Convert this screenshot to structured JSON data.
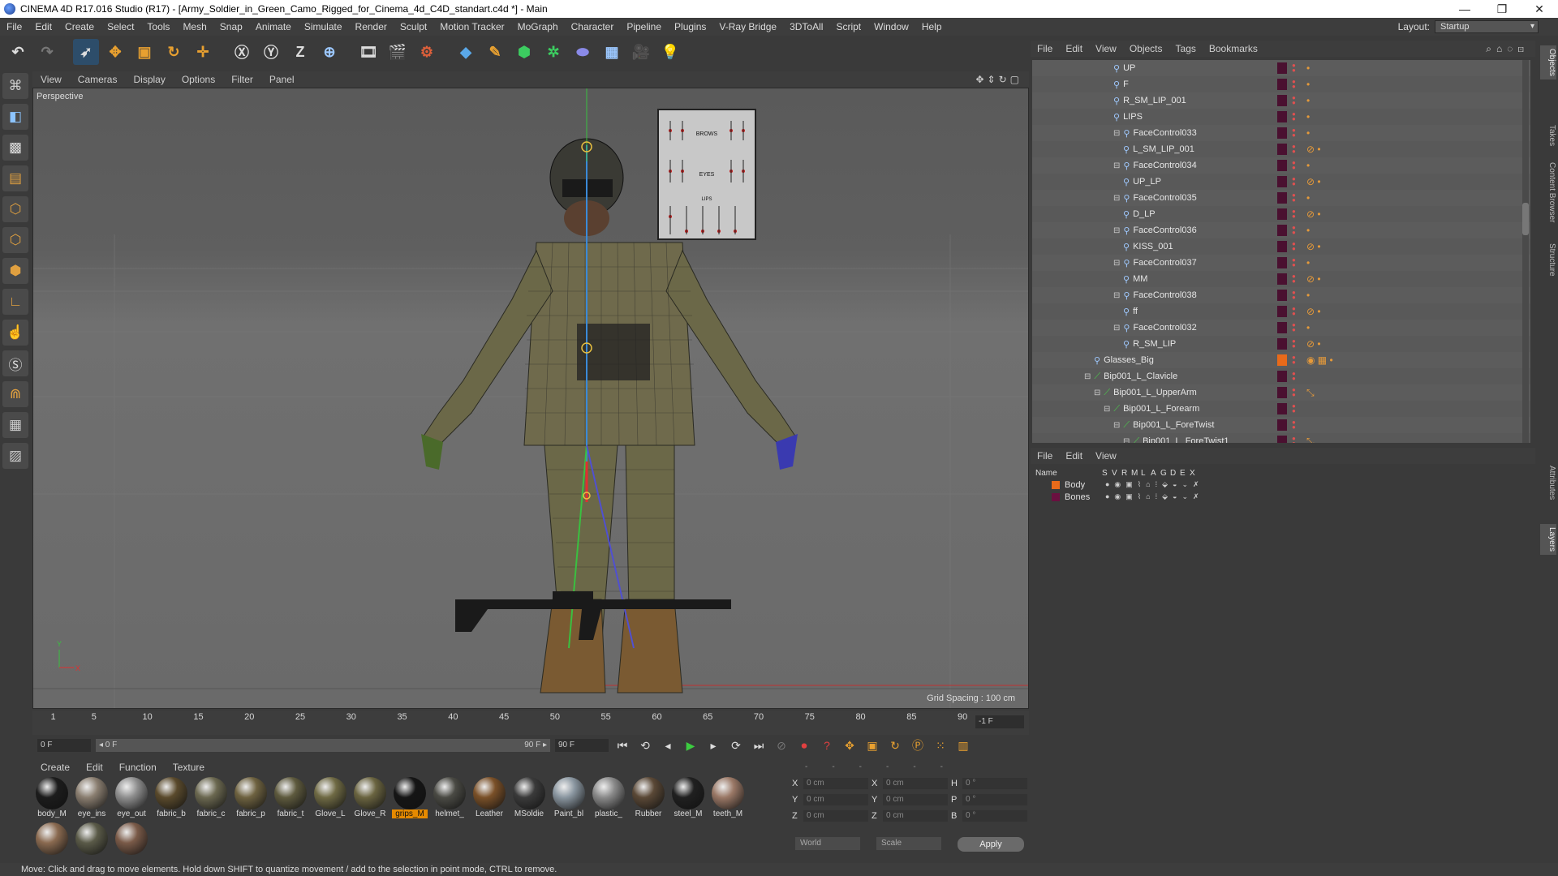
{
  "window": {
    "title": "CINEMA 4D R17.016 Studio (R17) - [Army_Soldier_in_Green_Camo_Rigged_for_Cinema_4d_C4D_standart.c4d *] - Main",
    "controls": [
      "—",
      "❐",
      "✕"
    ]
  },
  "main_menu": [
    "File",
    "Edit",
    "Create",
    "Select",
    "Tools",
    "Mesh",
    "Snap",
    "Animate",
    "Simulate",
    "Render",
    "Sculpt",
    "Motion Tracker",
    "MoGraph",
    "Character",
    "Pipeline",
    "Plugins",
    "V-Ray Bridge",
    "3DToAll",
    "Script",
    "Window",
    "Help"
  ],
  "layout": {
    "label": "Layout:",
    "value": "Startup"
  },
  "viewport": {
    "menu": [
      "View",
      "Cameras",
      "Display",
      "Options",
      "Filter",
      "Panel"
    ],
    "label": "Perspective",
    "grid_spacing": "Grid Spacing : 100 cm",
    "panel_labels": {
      "brows": "BROWS",
      "eyes": "EYES",
      "lips": "LIPS"
    },
    "axis_y": "Y",
    "axis_x": "X"
  },
  "timeline": {
    "ticks": [
      "1",
      "5",
      "10",
      "15",
      "20",
      "25",
      "30",
      "35",
      "40",
      "45",
      "50",
      "55",
      "60",
      "65",
      "70",
      "75",
      "80",
      "85",
      "90"
    ],
    "current_frame_display": "-1 F",
    "start_field": "0 F",
    "slider_left": "◂ 0 F",
    "slider_right": "90 F ▸",
    "end_field": "90 F"
  },
  "material_manager": {
    "menu": [
      "Create",
      "Edit",
      "Function",
      "Texture"
    ],
    "materials": [
      {
        "name": "body_M",
        "color": "#1c1c1c",
        "selected": false
      },
      {
        "name": "eye_ins",
        "color": "#8a7e70",
        "selected": false
      },
      {
        "name": "eye_out",
        "color": "#8f8f8f",
        "selected": false
      },
      {
        "name": "fabric_b",
        "color": "#5a4a2c",
        "selected": false
      },
      {
        "name": "fabric_c",
        "color": "#6b6850",
        "selected": false
      },
      {
        "name": "fabric_p",
        "color": "#6e6240",
        "selected": false
      },
      {
        "name": "fabric_t",
        "color": "#5e5a3e",
        "selected": false
      },
      {
        "name": "Glove_L",
        "color": "#6f6a44",
        "selected": false
      },
      {
        "name": "Glove_R",
        "color": "#6a6440",
        "selected": false
      },
      {
        "name": "grips_M",
        "color": "#151515",
        "selected": true
      },
      {
        "name": "helmet_",
        "color": "#4a4a44",
        "selected": false
      },
      {
        "name": "Leather",
        "color": "#7a5028",
        "selected": false
      },
      {
        "name": "MSoldie",
        "color": "#3a3a3a",
        "selected": false
      },
      {
        "name": "Paint_bl",
        "color": "#8a96a0",
        "selected": false
      },
      {
        "name": "plastic_",
        "color": "#8a8a8a",
        "selected": false
      },
      {
        "name": "Rubber",
        "color": "#5a4836",
        "selected": false
      },
      {
        "name": "steel_M",
        "color": "#202020",
        "selected": false
      },
      {
        "name": "teeth_M",
        "color": "#9a7866",
        "selected": false
      },
      {
        "name": "",
        "color": "#8a6a50",
        "selected": false
      },
      {
        "name": "",
        "color": "#5a5a48",
        "selected": false
      },
      {
        "name": "",
        "color": "#7a5a48",
        "selected": false
      }
    ]
  },
  "coordinates": {
    "header": [
      "--",
      "--",
      "--"
    ],
    "rows": [
      {
        "a": "X",
        "av": "0 cm",
        "b": "X",
        "bv": "0 cm",
        "c": "H",
        "cv": "0 °"
      },
      {
        "a": "Y",
        "av": "0 cm",
        "b": "Y",
        "bv": "0 cm",
        "c": "P",
        "cv": "0 °"
      },
      {
        "a": "Z",
        "av": "0 cm",
        "b": "Z",
        "bv": "0 cm",
        "c": "B",
        "cv": "0 °"
      }
    ],
    "world": "World",
    "scale": "Scale",
    "apply": "Apply"
  },
  "status": "Move: Click and drag to move elements. Hold down SHIFT to quantize movement / add to the selection in point mode, CTRL to remove.",
  "object_manager": {
    "menu": [
      "File",
      "Edit",
      "View",
      "Objects",
      "Tags",
      "Bookmarks"
    ],
    "rows": [
      {
        "name": "UP",
        "level": 4,
        "kind": "joint",
        "expand": false,
        "layer": "dark",
        "tags": "•"
      },
      {
        "name": "F",
        "level": 4,
        "kind": "joint",
        "expand": false,
        "layer": "dark",
        "tags": "•"
      },
      {
        "name": "R_SM_LIP_001",
        "level": 4,
        "kind": "joint",
        "expand": false,
        "layer": "dark",
        "tags": "•"
      },
      {
        "name": "LIPS",
        "level": 4,
        "kind": "joint",
        "expand": false,
        "layer": "dark",
        "tags": "•"
      },
      {
        "name": "FaceControl033",
        "level": 4,
        "kind": "joint",
        "expand": true,
        "layer": "dark",
        "tags": "•"
      },
      {
        "name": "L_SM_LIP_001",
        "level": 5,
        "kind": "joint",
        "expand": false,
        "layer": "dark",
        "tags": "⊘ •"
      },
      {
        "name": "FaceControl034",
        "level": 4,
        "kind": "joint",
        "expand": true,
        "layer": "dark",
        "tags": "•"
      },
      {
        "name": "UP_LP",
        "level": 5,
        "kind": "joint",
        "expand": false,
        "layer": "dark",
        "tags": "⊘ •"
      },
      {
        "name": "FaceControl035",
        "level": 4,
        "kind": "joint",
        "expand": true,
        "layer": "dark",
        "tags": "•"
      },
      {
        "name": "D_LP",
        "level": 5,
        "kind": "joint",
        "expand": false,
        "layer": "dark",
        "tags": "⊘ •"
      },
      {
        "name": "FaceControl036",
        "level": 4,
        "kind": "joint",
        "expand": true,
        "layer": "dark",
        "tags": "•"
      },
      {
        "name": "KISS_001",
        "level": 5,
        "kind": "joint",
        "expand": false,
        "layer": "dark",
        "tags": "⊘ •"
      },
      {
        "name": "FaceControl037",
        "level": 4,
        "kind": "joint",
        "expand": true,
        "layer": "dark",
        "tags": "•"
      },
      {
        "name": "MM",
        "level": 5,
        "kind": "joint",
        "expand": false,
        "layer": "dark",
        "tags": "⊘ •"
      },
      {
        "name": "FaceControl038",
        "level": 4,
        "kind": "joint",
        "expand": true,
        "layer": "dark",
        "tags": "•"
      },
      {
        "name": "ff",
        "level": 5,
        "kind": "joint",
        "expand": false,
        "layer": "dark",
        "tags": "⊘ •"
      },
      {
        "name": "FaceControl032",
        "level": 4,
        "kind": "joint",
        "expand": true,
        "layer": "dark",
        "tags": "•"
      },
      {
        "name": "R_SM_LIP",
        "level": 5,
        "kind": "joint",
        "expand": false,
        "layer": "dark",
        "tags": "⊘ •"
      },
      {
        "name": "Glasses_Big",
        "level": 2,
        "kind": "joint",
        "expand": false,
        "layer": "orange",
        "tags": "◉ ▦ •"
      },
      {
        "name": "Bip001_L_Clavicle",
        "level": 1,
        "kind": "bone",
        "expand": true,
        "layer": "dark",
        "tags": ""
      },
      {
        "name": "Bip001_L_UpperArm",
        "level": 2,
        "kind": "bone",
        "expand": true,
        "layer": "dark",
        "tags": "⤡"
      },
      {
        "name": "Bip001_L_Forearm",
        "level": 3,
        "kind": "bone",
        "expand": true,
        "layer": "dark",
        "tags": ""
      },
      {
        "name": "Bip001_L_ForeTwist",
        "level": 4,
        "kind": "bone",
        "expand": true,
        "layer": "dark",
        "tags": ""
      },
      {
        "name": "Bip001_L_ForeTwist1",
        "level": 5,
        "kind": "bone",
        "expand": true,
        "layer": "dark",
        "tags": "⤡"
      }
    ]
  },
  "layer_manager": {
    "menu": [
      "File",
      "Edit",
      "View"
    ],
    "columns": [
      "Name",
      "S",
      "V",
      "R",
      "M",
      "L",
      "A",
      "G",
      "D",
      "E",
      "X"
    ],
    "layers": [
      {
        "name": "Body",
        "color": "#e86a1a"
      },
      {
        "name": "Bones",
        "color": "#6a1040"
      }
    ]
  },
  "side_tabs": [
    "Objects",
    "Takes",
    "Content Browser",
    "Structure",
    "Attributes",
    "Layers"
  ]
}
